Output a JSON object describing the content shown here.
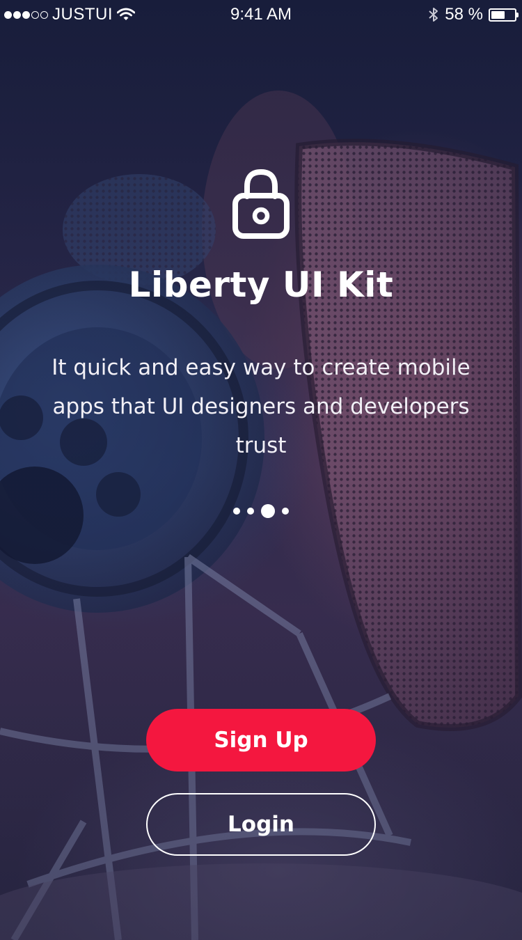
{
  "status_bar": {
    "carrier": "JUSTUI",
    "time": "9:41 AM",
    "battery_text": "58 %",
    "battery_level": 0.58,
    "signal_bars_filled": 3,
    "signal_bars_total": 5
  },
  "hero": {
    "icon": "lock-icon",
    "title": "Liberty UI Kit",
    "subtitle": "It quick and easy way to create mobile apps that UI designers and developers trust"
  },
  "pager": {
    "total": 4,
    "active_index": 2
  },
  "actions": {
    "signup_label": "Sign Up",
    "login_label": "Login"
  },
  "colors": {
    "accent": "#f4173f",
    "text": "#ffffff"
  }
}
